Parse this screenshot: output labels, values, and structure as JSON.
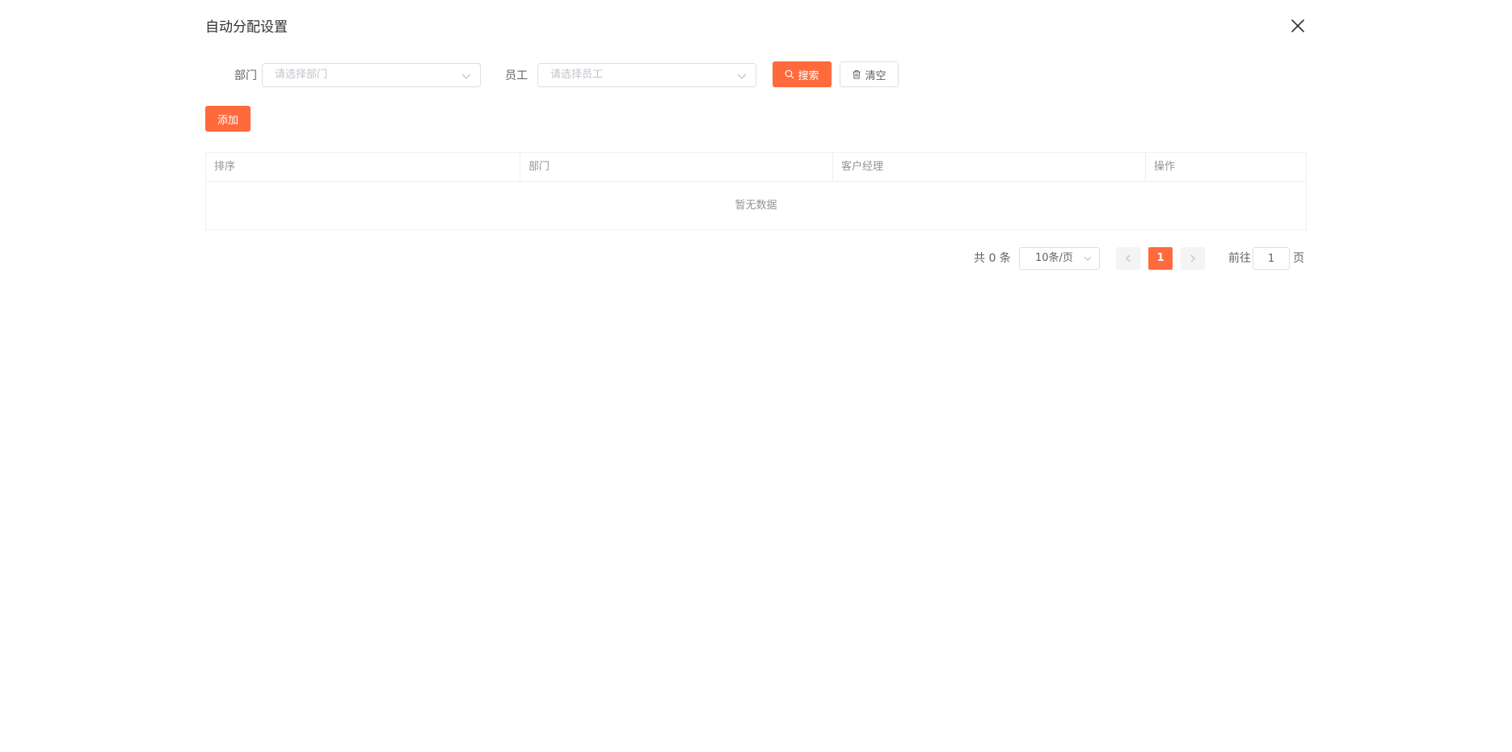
{
  "dialog": {
    "title": "自动分配设置"
  },
  "filters": {
    "department_label": "部门",
    "department_placeholder": "请选择部门",
    "employee_label": "员工",
    "employee_placeholder": "请选择员工",
    "search_label": "搜索",
    "clear_label": "清空"
  },
  "toolbar": {
    "add_label": "添加"
  },
  "table": {
    "columns": [
      "排序",
      "部门",
      "客户经理",
      "操作"
    ],
    "empty_text": "暂无数据"
  },
  "pagination": {
    "total_text": "共 0 条",
    "page_size": "10条/页",
    "current_page": "1",
    "goto_prefix": "前往",
    "goto_value": "1",
    "goto_suffix": "页"
  },
  "colors": {
    "primary": "#ff6a3d",
    "border": "#dcdfe6",
    "text": "#606266",
    "muted": "#909399"
  },
  "icons": {
    "close": "close-icon",
    "chevron": "chevron-down-icon",
    "search": "search-icon",
    "delete": "trash-icon",
    "prev": "chevron-left-icon",
    "next": "chevron-right-icon"
  }
}
